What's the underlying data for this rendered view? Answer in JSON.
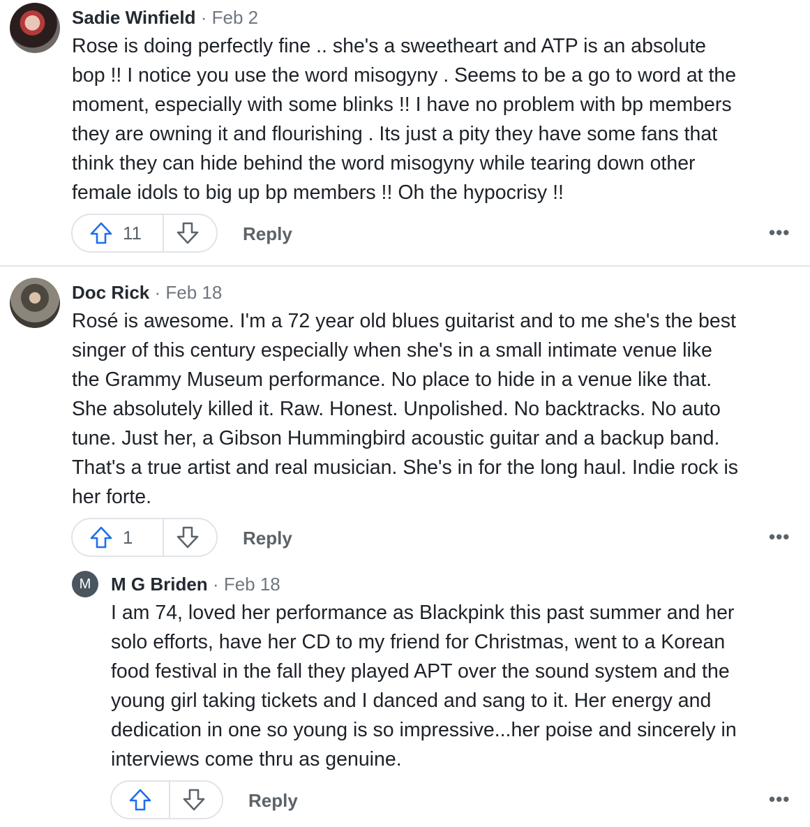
{
  "comments": [
    {
      "name": "Sadie Winfield",
      "date": "Feb 2",
      "lines": [
        "Rose is doing perfectly fine .. she's a sweetheart and ATP is an absolute",
        "bop !! I notice you use the word misogyny . Seems to be a go to word at the",
        "moment, especially with some blinks !! I have no problem with bp members",
        "they are owning it and flourishing . Its just a pity they have some fans that",
        "think they can hide behind the word misogyny while tearing down other",
        "female idols to big up bp members !! Oh the hypocrisy !!"
      ],
      "votes": "11",
      "reply": "Reply"
    },
    {
      "name": "Doc Rick",
      "date": "Feb 18",
      "lines": [
        "Rosé is awesome. I'm a 72 year old blues guitarist and to me she's the best",
        "singer of this century especially when she's in a small intimate venue like",
        "the Grammy Museum performance. No place to hide in a venue like that.",
        "She absolutely killed it. Raw. Honest. Unpolished. No backtracks. No auto",
        "tune. Just her, a Gibson Hummingbird acoustic guitar and a backup band.",
        "That's a true artist and real musician. She's in for the long haul. Indie rock is",
        "her forte."
      ],
      "votes": "1",
      "reply": "Reply"
    },
    {
      "name": "M G Briden",
      "avatar_letter": "M",
      "date": "Feb 18",
      "lines": [
        "I am 74, loved her performance as Blackpink this past summer and her",
        "solo efforts, have her CD to my friend for Christmas, went to a Korean",
        "food festival in the fall they played APT over the sound system and the",
        "young girl taking tickets and I danced and sang to it. Her energy and",
        "dedication in one so young is so impressive...her poise and sincerely in",
        "interviews come thru as genuine."
      ],
      "votes": "",
      "reply": "Reply"
    }
  ],
  "separator_dot": "·",
  "more_glyph": "•••",
  "icons": {
    "up": "arrow-up-icon",
    "down": "arrow-down-icon",
    "more": "more-options-icon"
  },
  "colors": {
    "upvote": "#1d6ef0",
    "neutral": "#5b636a"
  }
}
